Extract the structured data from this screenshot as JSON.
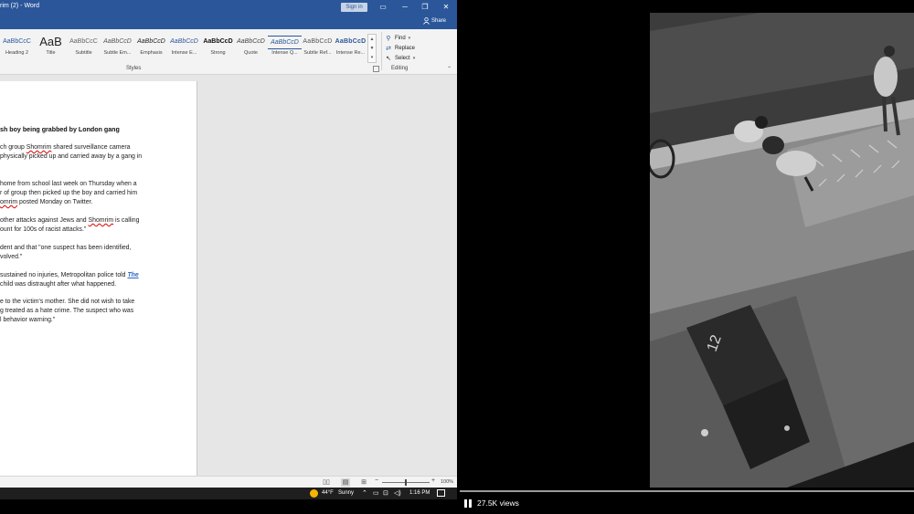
{
  "word": {
    "window_title": "rim (2) - Word",
    "sign_in_label": "Sign in",
    "share_label": "Share",
    "styles": [
      {
        "sample": "AaBbCcC",
        "name": "Heading 2"
      },
      {
        "sample": "AaB",
        "name": "Title"
      },
      {
        "sample": "AaBbCcC",
        "name": "Subtitle"
      },
      {
        "sample": "AaBbCcD",
        "name": "Subtle Em..."
      },
      {
        "sample": "AaBbCcD",
        "name": "Emphasis"
      },
      {
        "sample": "AaBbCcD",
        "name": "Intense E..."
      },
      {
        "sample": "AaBbCcD",
        "name": "Strong"
      },
      {
        "sample": "AaBbCcD",
        "name": "Quote"
      },
      {
        "sample": "AaBbCcD",
        "name": "Intense Q..."
      },
      {
        "sample": "AaBbCcD",
        "name": "Subtle Ref..."
      },
      {
        "sample": "AaBbCcD",
        "name": "Intense Re..."
      }
    ],
    "styles_group_label": "Styles",
    "editing": {
      "find": "Find",
      "replace": "Replace",
      "select": "Select",
      "group_label": "Editing"
    },
    "document": {
      "title": "sh boy being grabbed by London gang",
      "lines": {
        "p1_l1_a": "ch group ",
        "p1_l1_spell": "Shomrim",
        "p1_l1_b": " shared surveillance camera",
        "p1_l2": "physically picked up and carried away by a gang in",
        "p2_l1": "home from school last week on Thursday when a",
        "p2_l2": "r of group then picked up the boy and carried him",
        "p2_l3_spell": "omrim",
        "p2_l3_b": " posted Monday on Twitter.",
        "p3_l1_a": "other attacks against Jews and ",
        "p3_l1_spell": "Shomrim",
        "p3_l1_b": " is calling",
        "p3_l2": "ount for 100s of racist attacks.\"",
        "p4_l1": "dent and that \"one suspect has been identified,",
        "p4_l2": "volved.\"",
        "p5_l1_a": "sustained no injuries, Metropolitan police told ",
        "p5_l1_link": "The",
        "p5_l2": "child was distraught after what happened.",
        "p6_l1": "e to the victim's mother. She did not wish to take",
        "p6_l2": "g treated as a hate crime. The suspect who was",
        "p6_l3": "l behavior warning.\""
      }
    },
    "zoom_level": "100%"
  },
  "taskbar": {
    "temperature": "44°F",
    "condition": "Sunny",
    "time": "1:16 PM"
  },
  "video": {
    "views": "27.5K views",
    "scene_number": "12"
  },
  "colors": {
    "word_blue": "#2b579a",
    "link_blue": "#2e66c4",
    "spell_red": "#d00000"
  }
}
